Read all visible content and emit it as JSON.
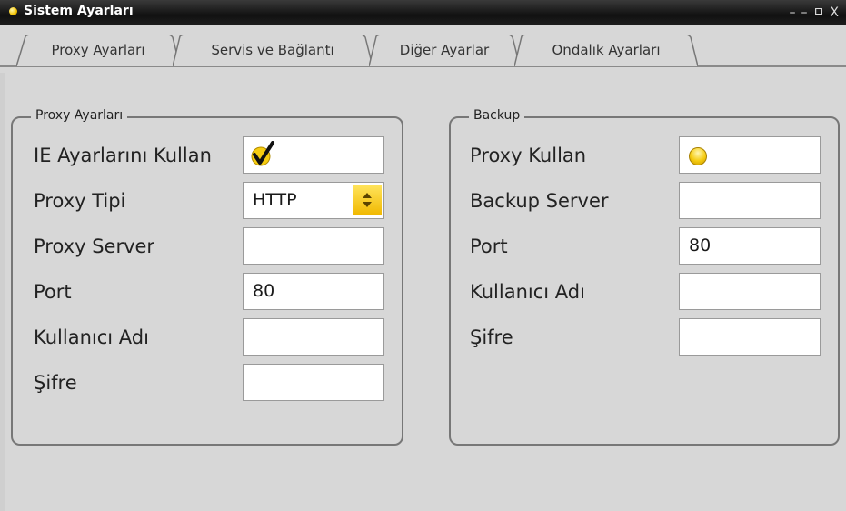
{
  "window": {
    "title": "Sistem Ayarları",
    "controls": [
      "–",
      "–",
      "ㅁ",
      "X"
    ]
  },
  "tabs": [
    {
      "label": "Proxy Ayarları",
      "active": true
    },
    {
      "label": "Servis ve Bağlantı",
      "active": false
    },
    {
      "label": "Diğer Ayarlar",
      "active": false
    },
    {
      "label": "Ondalık Ayarları",
      "active": false
    }
  ],
  "proxy_group": {
    "title": "Proxy Ayarları",
    "ie_settings_label": "IE Ayarlarını Kullan",
    "ie_settings_checked": true,
    "proxy_type_label": "Proxy Tipi",
    "proxy_type_value": "HTTP",
    "proxy_server_label": "Proxy Server",
    "proxy_server_value": "",
    "port_label": "Port",
    "port_value": "80",
    "username_label": "Kullanıcı Adı",
    "username_value": "",
    "password_label": "Şifre",
    "password_value": ""
  },
  "backup_group": {
    "title": "Backup",
    "use_proxy_label": "Proxy Kullan",
    "use_proxy_selected": false,
    "backup_server_label": "Backup Server",
    "backup_server_value": "",
    "port_label": "Port",
    "port_value": "80",
    "username_label": "Kullanıcı Adı",
    "username_value": "",
    "password_label": "Şifre",
    "password_value": ""
  },
  "colors": {
    "accent": "#f2c200",
    "titlebar": "#1a1a1a",
    "background": "#d7d7d7"
  }
}
